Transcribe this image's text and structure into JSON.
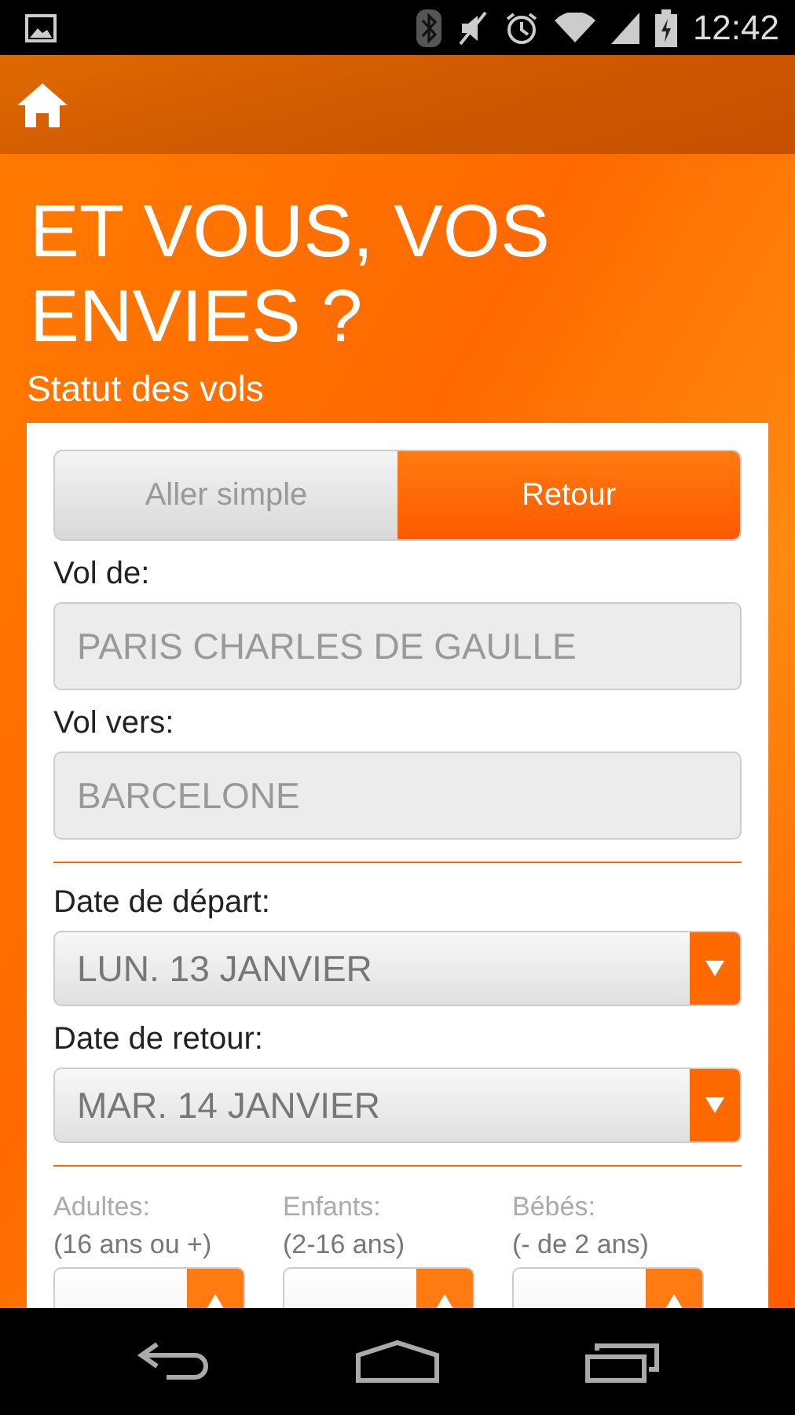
{
  "status_bar": {
    "time": "12:42"
  },
  "title": "ET VOUS, VOS ENVIES ?",
  "subtitle": "Statut des vols",
  "trip_type": [
    {
      "label": "Aller simple",
      "selected": false
    },
    {
      "label": "Retour",
      "selected": true
    }
  ],
  "airports": [
    {
      "label": "Vol de:",
      "value": "PARIS CHARLES DE GAULLE"
    },
    {
      "label": "Vol vers:",
      "value": "BARCELONE"
    }
  ],
  "dates": [
    {
      "label": "Date de départ:",
      "value": "LUN. 13 JANVIER"
    },
    {
      "label": "Date de retour:",
      "value": "MAR. 14 JANVIER"
    }
  ],
  "passengers": [
    {
      "label": "Adultes:",
      "note": "(16 ans ou +)"
    },
    {
      "label": "Enfants:",
      "note": "(2-16 ans)"
    },
    {
      "label": "Bébés:",
      "note": "(- de 2 ans)"
    }
  ]
}
